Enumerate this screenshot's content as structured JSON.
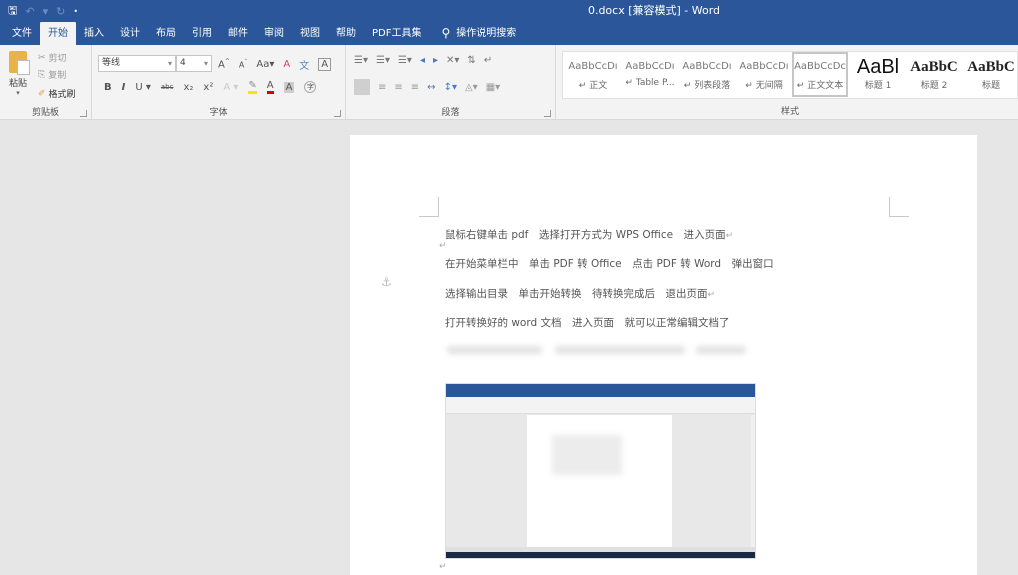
{
  "titlebar": {
    "title": "0.docx [兼容模式] - Word",
    "qat": {
      "save_icon": "save-icon",
      "undo_icon": "undo-icon",
      "redo_icon": "redo-icon",
      "customize_icon": "customize-qat-icon"
    }
  },
  "tabs": [
    {
      "label": "文件",
      "active": false
    },
    {
      "label": "开始",
      "active": true
    },
    {
      "label": "插入",
      "active": false
    },
    {
      "label": "设计",
      "active": false
    },
    {
      "label": "布局",
      "active": false
    },
    {
      "label": "引用",
      "active": false
    },
    {
      "label": "邮件",
      "active": false
    },
    {
      "label": "审阅",
      "active": false
    },
    {
      "label": "视图",
      "active": false
    },
    {
      "label": "帮助",
      "active": false
    },
    {
      "label": "PDF工具集",
      "active": false
    }
  ],
  "tell_me": {
    "label": "操作说明搜索",
    "icon": "lightbulb-icon"
  },
  "ribbon": {
    "clipboard": {
      "label": "剪贴板",
      "paste": "粘贴",
      "cut": "剪切",
      "copy": "复制",
      "format_painter": "格式刷"
    },
    "font": {
      "label": "字体",
      "font_name": "等线",
      "font_size": "4",
      "row1": [
        "A↑",
        "A↓",
        "Aa ▾",
        "清除格式",
        "拼音",
        "字符边框"
      ],
      "row2": [
        "B",
        "I",
        "U ▾",
        "abc",
        "x₂",
        "x²",
        "文本效果 ▾",
        "突出显示 ▾",
        "字体颜色 ▾",
        "字符底纹",
        "带圈字符"
      ]
    },
    "paragraph": {
      "label": "段落"
    },
    "styles": {
      "label": "样式",
      "items": [
        {
          "sample": "AaBbCcDı",
          "name": "↵ 正文"
        },
        {
          "sample": "AaBbCcDı",
          "name": "↵ Table P..."
        },
        {
          "sample": "AaBbCcDı",
          "name": "↵ 列表段落"
        },
        {
          "sample": "AaBbCcDı",
          "name": "↵ 无间隔"
        },
        {
          "sample": "AaBbCcDc",
          "name": "↵ 正文文本"
        },
        {
          "sample": "AaBl",
          "name": "标题 1"
        },
        {
          "sample": "AaBbC",
          "name": "标题 2"
        },
        {
          "sample": "AaBbC",
          "name": "标题"
        }
      ]
    }
  },
  "document": {
    "paragraphs": [
      "鼠标右键单击 pdf　选择打开方式为 WPS Office　进入页面",
      "在开始菜单栏中　单击 PDF 转 Office　点击 PDF 转 Word　弹出窗口",
      "选择输出目录　单击开始转换　待转换完成后　退出页面",
      "打开转换好的 word 文档　进入页面　就可以正常编辑文档了"
    ],
    "paragraph_mark": "↵",
    "embedded_image": "word-screenshot-image"
  }
}
